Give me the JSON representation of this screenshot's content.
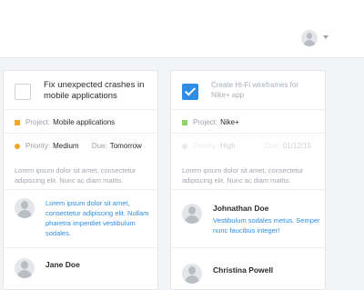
{
  "cards": [
    {
      "title": "Fix unexpected crashes in mobile applications",
      "checked": false,
      "project_label": "Project:",
      "project_value": "Mobile applications",
      "project_color": "#f5a623",
      "priority_label": "Priority:",
      "priority_value": "Medium",
      "priority_color": "#f5a623",
      "due_label": "Due:",
      "due_value": "Tomorrow",
      "description": "Lorem ipsum dolor sit amet, consectetur adipiscing elit. Nunc ac diam mattis.",
      "comments": [
        {
          "name": "",
          "text": "Lorem ipsum dolor sit amet, consectetur adipiscing elit. Nullam pharetra imperdiet vestibulum sodales."
        },
        {
          "name": "Jane Doe",
          "text": ""
        }
      ]
    },
    {
      "title": "Create Hi-Fi wireframes for Nike+ app",
      "checked": true,
      "project_label": "Project:",
      "project_value": "Nike+",
      "project_color": "#8fd16c",
      "priority_label": "Priority:",
      "priority_value": "High",
      "priority_color": "#d8dbe0",
      "due_label": "Due:",
      "due_value": "01/12/15",
      "description": "Lorem ipsum dolor sit amet, consectetur adipiscing elit. Nunc ac diam mattis.",
      "comments": [
        {
          "name": "Johnathan Doe",
          "text": "Vestibulum sodales metus. Semper nunc faucibus integer!"
        },
        {
          "name": "Christina Powell",
          "text": ""
        }
      ]
    }
  ]
}
